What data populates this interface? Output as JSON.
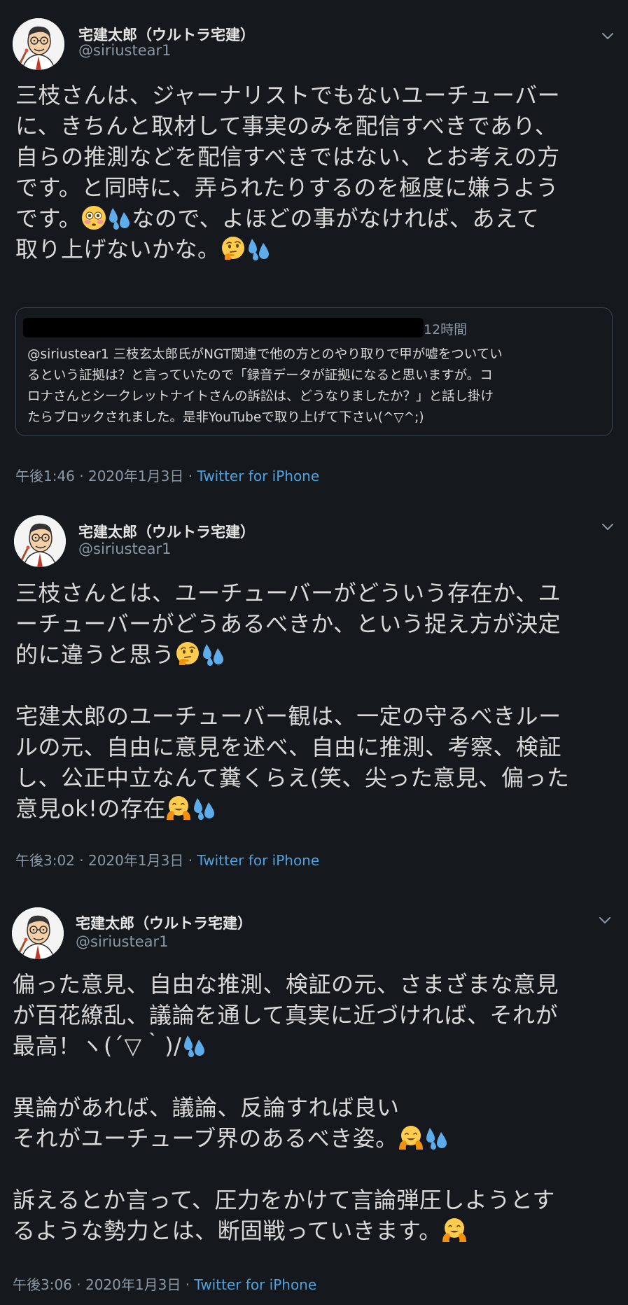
{
  "tweets": [
    {
      "display_name": "宅建太郎（ウルトラ宅建）",
      "handle": "@siriustear1",
      "lines": [
        "三枝さんは、ジャーナリストでもないユーチューバー",
        "に、きちんと取材して事実のみを配信すべきであり、",
        "自らの推測などを配信すべきではない、とお考えの方",
        "です。と同時に、弄られたりするのを極度に嫌うよう",
        "です。",
        "なので、よほどの事がなければ、あえて",
        "取り上げないかな。"
      ],
      "quote": {
        "time": "12時間",
        "lines": [
          "@siriustear1 三枝玄太郎氏がNGT関連で他の方とのやり取りで甲が嘘をついてい",
          "るという証拠は？と言っていたので「録音データが証拠になると思いますが。コ",
          "ロナさんとシークレットナイトさんの訴訟は、どうなりましたか？」と話し掛け",
          "たらブロックされました。是非YouTubeで取り上げて下さい(^▽^;)"
        ]
      },
      "time": "午後1:46 · 2020年1月3日 ·",
      "source": "Twitter for iPhone"
    },
    {
      "display_name": "宅建太郎（ウルトラ宅建）",
      "handle": "@siriustear1",
      "lines": [
        "三枝さんとは、ユーチューバーがどういう存在か、ユ",
        "ーチューバーがどうあるべきか、という捉え方が決定",
        "的に違うと思う",
        "宅建太郎のユーチューバー観は、一定の守るべきルー",
        "ルの元、自由に意見を述べ、自由に推測、考察、検証",
        "し、公正中立なんて糞くらえ(笑、尖った意見、偏った",
        "意見ok!の存在"
      ],
      "time": "午後3:02 · 2020年1月3日 ·",
      "source": "Twitter for iPhone"
    },
    {
      "display_name": "宅建太郎（ウルトラ宅建）",
      "handle": "@siriustear1",
      "lines": [
        "偏った意見、自由な推測、検証の元、さまざまな意見",
        "が百花繚乱、議論を通して真実に近づければ、それが",
        "最高！ヽ(´▽｀)/",
        "異論があれば、議論、反論すれば良い",
        "それがユーチューブ界のあるべき姿。",
        "訴えるとか言って、圧力をかけて言論弾圧しようとす",
        "るような勢力とは、断固戦っていきます。"
      ],
      "time": "午後3:06 · 2020年1月3日 ·",
      "source": "Twitter for iPhone"
    }
  ],
  "icons": [
    "avatar",
    "chevron-down-icon",
    "flushed-face-emoji",
    "sweat-droplets-emoji",
    "thinking-face-emoji",
    "hugging-face-emoji"
  ],
  "colors": {
    "background": "#15181c",
    "text": "#d9d9d9",
    "secondary": "#8b98a5",
    "link": "#4da3e0",
    "border": "#3a444e"
  }
}
